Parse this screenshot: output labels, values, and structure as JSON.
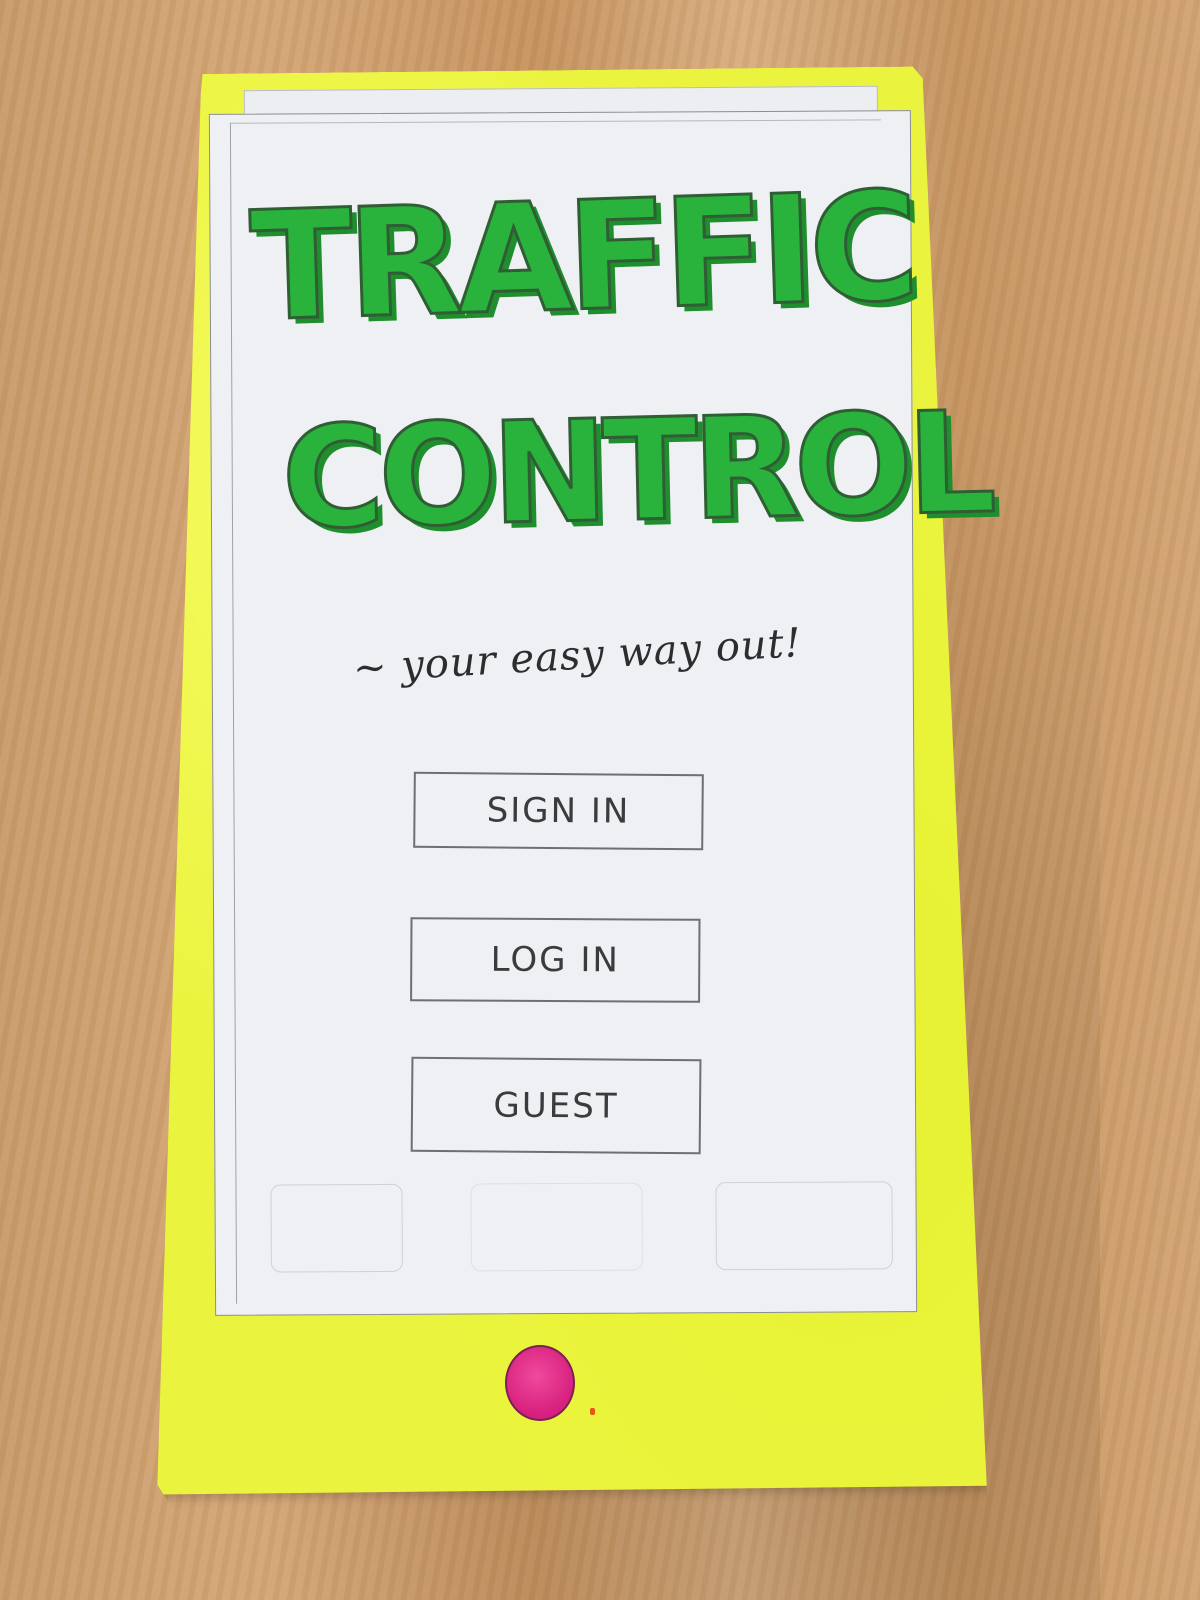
{
  "app": {
    "logo_line_1": "TRAFFIC",
    "logo_line_2": "CONTROL",
    "tagline": "~ your easy way out!"
  },
  "buttons": {
    "sign_in": "SIGN  IN",
    "log_in": "LOG  IN",
    "guest": "GUEST"
  },
  "colors": {
    "phone_frame": "#eaf43e",
    "logo_green": "#29b23c",
    "home_button": "#d61f7e",
    "screen": "#eef0f4"
  },
  "icons": {
    "home_button": "home-button-circle"
  }
}
